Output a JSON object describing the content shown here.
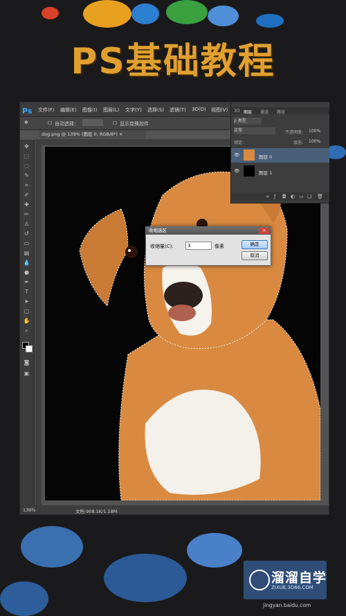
{
  "title": "PS基础教程",
  "photoshop": {
    "logo": "Ps",
    "menu": [
      "文件(F)",
      "编辑(E)",
      "图像(I)",
      "图层(L)",
      "文字(Y)",
      "选择(S)",
      "滤镜(T)",
      "3D(D)",
      "视图(V)"
    ],
    "options": {
      "auto_select": "自动选择：",
      "show_transform": "显示变换控件"
    },
    "doc_tab": "dog.png @ 139% (图层 0, RGB/8*) ×",
    "status": {
      "zoom": "139%",
      "doc": "文档:908.1K/1.18M"
    },
    "layers_panel": {
      "tabs": [
        "3D",
        "图层",
        "通道",
        "路径"
      ],
      "kind": "ρ 类型",
      "blend_mode": "正常",
      "opacity_label": "不透明度:",
      "opacity_value": "100%",
      "lock_label": "锁定:",
      "fill_label": "填充:",
      "fill_value": "100%",
      "layers": [
        "图层 0",
        "图层 1"
      ]
    },
    "dialog": {
      "title": "收缩选区",
      "close": "×",
      "field_label": "收缩量(C):",
      "field_value": "3",
      "unit": "像素",
      "ok": "确定",
      "cancel": "取消"
    }
  },
  "brand": {
    "logo_text": "溜溜自学",
    "logo_sub": "ZIXUE.3D66.COM",
    "watermark": "jingyan.baidu.com"
  },
  "colors": {
    "title": "#e0a030",
    "brand_bg": "#2f4d77",
    "ps_blue": "#31a8ff"
  }
}
